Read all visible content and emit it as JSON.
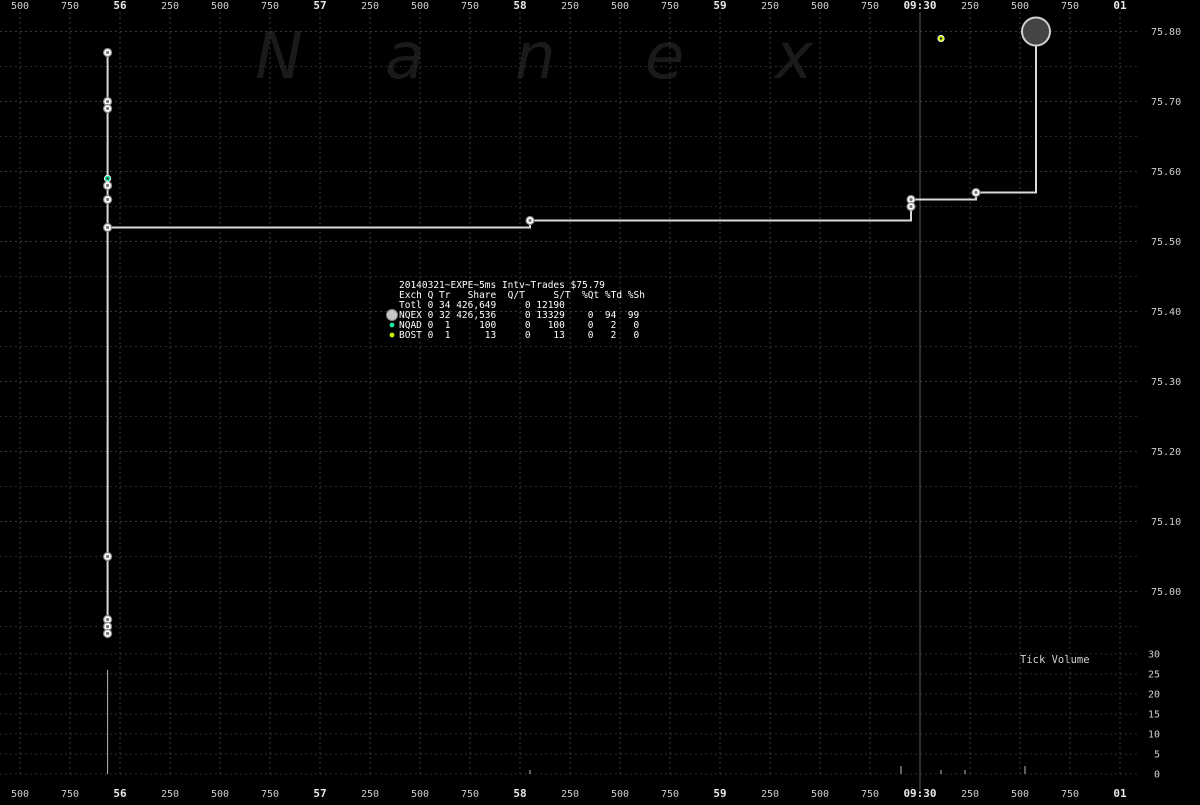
{
  "chart_data": {
    "type": "line",
    "watermark": [
      "N",
      "a",
      "n",
      "e",
      "x"
    ],
    "x_ticks": {
      "top": [
        "500",
        "750",
        "56",
        "250",
        "500",
        "750",
        "57",
        "250",
        "500",
        "750",
        "58",
        "250",
        "500",
        "750",
        "59",
        "250",
        "500",
        "750",
        "09:30",
        "250",
        "500",
        "750",
        "01"
      ],
      "bottom": [
        "500",
        "750",
        "56",
        "250",
        "500",
        "750",
        "57",
        "250",
        "500",
        "750",
        "58",
        "250",
        "500",
        "750",
        "59",
        "250",
        "500",
        "750",
        "09:30",
        "250",
        "500",
        "750",
        "01"
      ],
      "bold": [
        "56",
        "57",
        "58",
        "59",
        "09:30",
        "01"
      ]
    },
    "price_axis": {
      "ticks": [
        "75.80",
        "75.70",
        "75.60",
        "75.50",
        "75.40",
        "75.30",
        "75.20",
        "75.10",
        "75.00"
      ],
      "min": 74.93,
      "max": 75.83
    },
    "volume_axis": {
      "title": "Tick Volume",
      "ticks": [
        "30",
        "25",
        "20",
        "15",
        "10",
        "5",
        "0"
      ],
      "max": 30
    },
    "series": [
      {
        "name": "NQEX",
        "color": "#d9d9d9",
        "step_line": [
          {
            "t": 55.938,
            "p": 75.77
          },
          {
            "t": 55.938,
            "p": 74.94
          },
          {
            "t": 55.938,
            "p": 75.52
          },
          {
            "t": 58.05,
            "p": 75.52
          },
          {
            "t": 58.05,
            "p": 75.53
          },
          {
            "t": 59.955,
            "p": 75.53
          },
          {
            "t": 59.955,
            "p": 75.56
          },
          {
            "t": 60.28,
            "p": 75.56
          },
          {
            "t": 60.28,
            "p": 75.57
          },
          {
            "t": 60.58,
            "p": 75.57
          },
          {
            "t": 60.58,
            "p": 75.8
          }
        ],
        "points": [
          {
            "t": 55.938,
            "p": 75.77
          },
          {
            "t": 55.938,
            "p": 75.7
          },
          {
            "t": 55.938,
            "p": 75.69
          },
          {
            "t": 55.938,
            "p": 75.58
          },
          {
            "t": 55.938,
            "p": 75.56
          },
          {
            "t": 55.938,
            "p": 75.52
          },
          {
            "t": 55.938,
            "p": 75.05
          },
          {
            "t": 55.938,
            "p": 74.96
          },
          {
            "t": 55.938,
            "p": 74.95
          },
          {
            "t": 55.938,
            "p": 74.94
          },
          {
            "t": 58.05,
            "p": 75.53
          },
          {
            "t": 59.955,
            "p": 75.56
          },
          {
            "t": 59.955,
            "p": 75.55
          },
          {
            "t": 60.28,
            "p": 75.57
          }
        ],
        "big_point": {
          "t": 60.58,
          "p": 75.8
        }
      },
      {
        "name": "NQAD",
        "color": "#22e0a0",
        "points": [
          {
            "t": 55.938,
            "p": 75.59
          }
        ]
      },
      {
        "name": "BOST",
        "color": "#c8f000",
        "points": [
          {
            "t": 60.105,
            "p": 75.79
          }
        ]
      }
    ],
    "volume_bars": [
      {
        "t": 55.938,
        "v": 26
      },
      {
        "t": 58.05,
        "v": 1
      },
      {
        "t": 59.905,
        "v": 2
      },
      {
        "t": 60.105,
        "v": 1
      },
      {
        "t": 60.225,
        "v": 1
      },
      {
        "t": 60.525,
        "v": 2
      }
    ],
    "session_line_t": 60.0
  },
  "legend": {
    "title": "20140321~EXPE~5ms Intv~Trades $75.79",
    "header": "Exch Q Tr   Share  Q/T     S/T  %Qt %Td %Sh",
    "rows": [
      {
        "marker": "none",
        "marker_color": "",
        "text": "Totl 0 34 426,649     0 12190"
      },
      {
        "marker": "large",
        "marker_color": "#c8c8c8",
        "text": "NQEX 0 32 426,536     0 13329    0  94  99"
      },
      {
        "marker": "small",
        "marker_color": "#22e0a0",
        "text": "NQAD 0  1     100     0   100    0   2   0"
      },
      {
        "marker": "small",
        "marker_color": "#c8f000",
        "text": "BOST 0  1      13     0    13    0   2   0"
      }
    ]
  }
}
